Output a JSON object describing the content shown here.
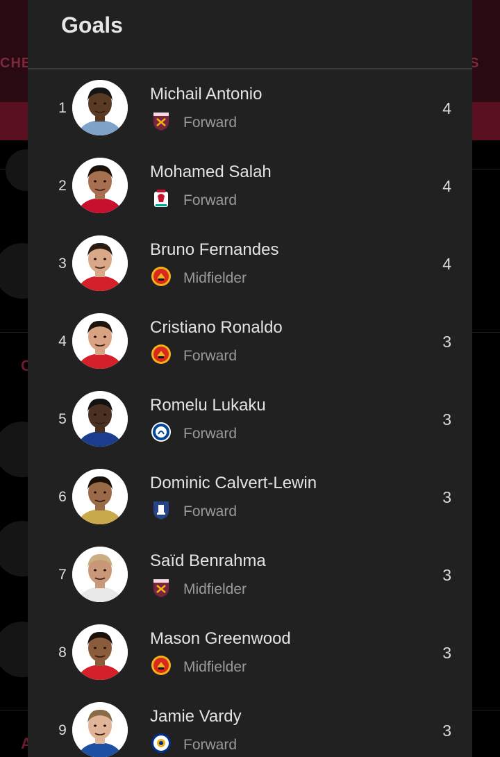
{
  "background": {
    "tab_left_partial": "CHES",
    "tab_right_partial": "S",
    "letter_a": "C",
    "letter_b": "A"
  },
  "sheet": {
    "title": "Goals"
  },
  "players": [
    {
      "rank": "1",
      "name": "Michail Antonio",
      "position": "Forward",
      "goals": "4",
      "club": "west-ham",
      "club_color": "#7a263a",
      "shirt": "#7fa3c8",
      "skin": "#5a3a22",
      "hair": "#151515"
    },
    {
      "rank": "2",
      "name": "Mohamed Salah",
      "position": "Forward",
      "goals": "4",
      "club": "liverpool",
      "club_color": "#c8102e",
      "shirt": "#c8102e",
      "skin": "#a87050",
      "hair": "#1a1208"
    },
    {
      "rank": "3",
      "name": "Bruno Fernandes",
      "position": "Midfielder",
      "goals": "4",
      "club": "man-utd",
      "club_color": "#da291c",
      "shirt": "#d4202a",
      "skin": "#d8a888",
      "hair": "#2a1a10"
    },
    {
      "rank": "4",
      "name": "Cristiano Ronaldo",
      "position": "Forward",
      "goals": "3",
      "club": "man-utd",
      "club_color": "#da291c",
      "shirt": "#d4202a",
      "skin": "#d9a383",
      "hair": "#1e140c"
    },
    {
      "rank": "5",
      "name": "Romelu Lukaku",
      "position": "Forward",
      "goals": "3",
      "club": "chelsea",
      "club_color": "#034694",
      "shirt": "#1a3d8f",
      "skin": "#4a3020",
      "hair": "#121212"
    },
    {
      "rank": "6",
      "name": "Dominic Calvert-Lewin",
      "position": "Forward",
      "goals": "3",
      "club": "everton",
      "club_color": "#274488",
      "shirt": "#c9a94a",
      "skin": "#9a6a48",
      "hair": "#1a1008"
    },
    {
      "rank": "7",
      "name": "Saïd Benrahma",
      "position": "Midfielder",
      "goals": "3",
      "club": "west-ham",
      "club_color": "#7a263a",
      "shirt": "#e8e8e8",
      "skin": "#c89878",
      "hair": "#c8b080"
    },
    {
      "rank": "8",
      "name": "Mason Greenwood",
      "position": "Midfielder",
      "goals": "3",
      "club": "man-utd",
      "club_color": "#da291c",
      "shirt": "#d4202a",
      "skin": "#8a5c3c",
      "hair": "#1a1008"
    },
    {
      "rank": "9",
      "name": "Jamie Vardy",
      "position": "Forward",
      "goals": "3",
      "club": "leicester",
      "club_color": "#003090",
      "shirt": "#1f4fa0",
      "skin": "#e0b496",
      "hair": "#8a6a48"
    }
  ]
}
